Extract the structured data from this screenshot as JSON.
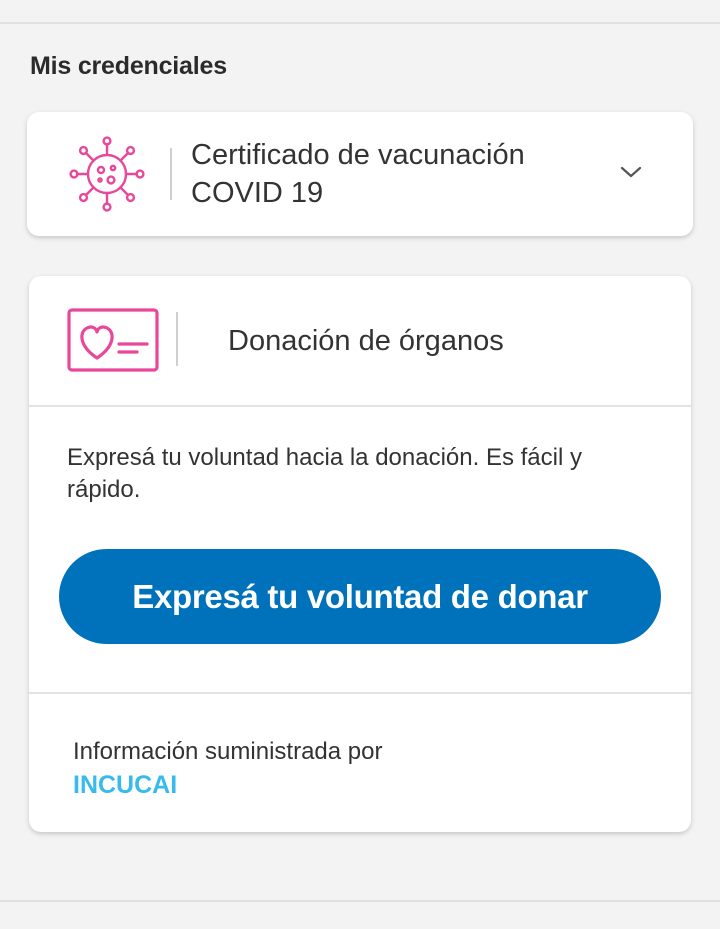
{
  "section": {
    "title": "Mis credenciales"
  },
  "covid_card": {
    "title": "Certificado de vacunación COVID 19",
    "icon": "virus-icon",
    "expand_icon": "chevron-down-icon"
  },
  "donation_card": {
    "title": "Donación de órganos",
    "icon": "heart-card-icon",
    "description": "Expresá tu voluntad hacia la donación. Es fácil y rápido.",
    "cta_label": "Expresá tu voluntad de donar",
    "info_label": "Información suministrada por",
    "info_link": "INCUCAI"
  },
  "colors": {
    "background": "#f3f3f3",
    "card": "#ffffff",
    "accent_pink": "#e8479a",
    "primary_button": "#0072bb",
    "link": "#37bbed",
    "text": "#333333"
  }
}
